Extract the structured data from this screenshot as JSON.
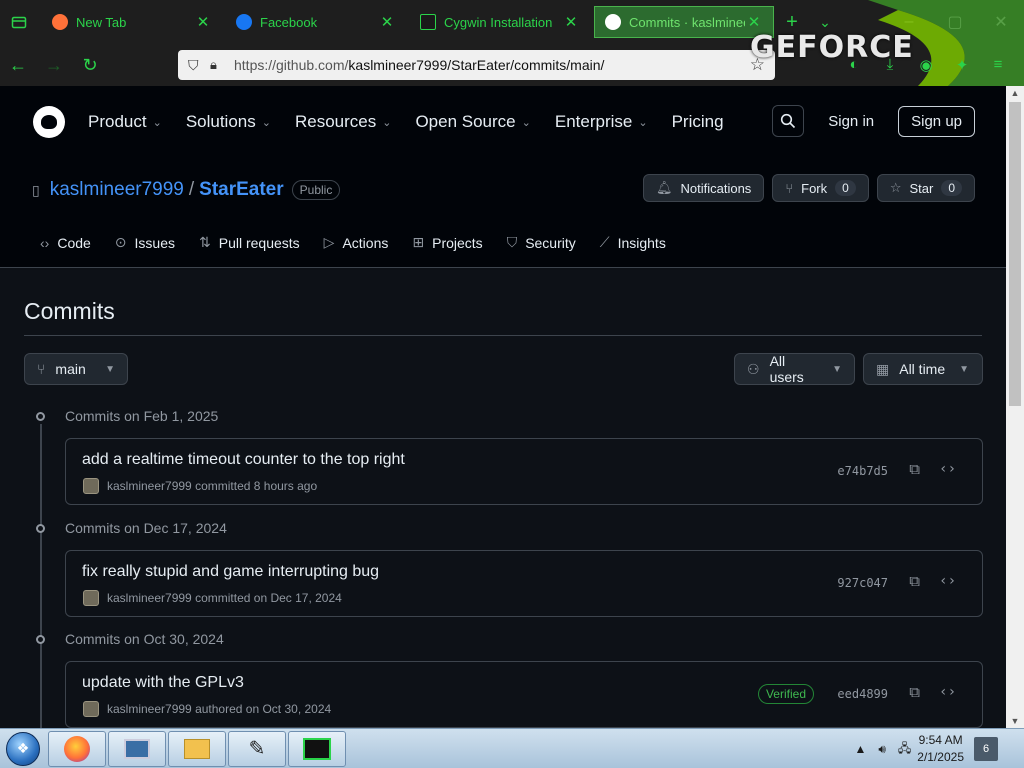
{
  "browser": {
    "tabs": [
      {
        "label": "New Tab",
        "fav_color": "#ff7139"
      },
      {
        "label": "Facebook",
        "fav_color": "#1877f2"
      },
      {
        "label": "Cygwin Installation",
        "fav_color": "#1a1a1a"
      },
      {
        "label": "Commits · kaslmineer",
        "fav_color": "#ffffff"
      }
    ],
    "url_host": "https://github.com/",
    "url_path": "kaslmineer7999/StarEater/commits/main/",
    "overlay_logo": "GEFORCE",
    "accent_color": "#2bd34a"
  },
  "gh_header": {
    "menu": [
      "Product",
      "Solutions",
      "Resources",
      "Open Source",
      "Enterprise",
      "Pricing"
    ],
    "sign_in": "Sign in",
    "sign_up": "Sign up"
  },
  "repo": {
    "owner": "kaslmineer7999",
    "separator": "/",
    "name": "StarEater",
    "visibility": "Public",
    "notifications_label": "Notifications",
    "fork_label": "Fork",
    "fork_count": "0",
    "star_label": "Star",
    "star_count": "0",
    "tabs": [
      "Code",
      "Issues",
      "Pull requests",
      "Actions",
      "Projects",
      "Security",
      "Insights"
    ]
  },
  "commits_page": {
    "title": "Commits",
    "branch": "main",
    "users_filter": "All users",
    "time_filter": "All time",
    "groups": [
      {
        "heading": "Commits on Feb 1, 2025",
        "commits": [
          {
            "message": "add a realtime timeout counter to the top right",
            "author": "kaslmineer7999",
            "action": "committed",
            "when": "8 hours ago",
            "sha": "e74b7d5",
            "verified": ""
          }
        ]
      },
      {
        "heading": "Commits on Dec 17, 2024",
        "commits": [
          {
            "message": "fix really stupid and game interrupting bug",
            "author": "kaslmineer7999",
            "action": "committed",
            "when": "on Dec 17, 2024",
            "sha": "927c047",
            "verified": ""
          }
        ]
      },
      {
        "heading": "Commits on Oct 30, 2024",
        "commits": [
          {
            "message": "update with the GPLv3",
            "author": "kaslmineer7999",
            "action": "authored",
            "when": "on Oct 30, 2024",
            "sha": "eed4899",
            "verified": "Verified"
          }
        ]
      }
    ]
  },
  "taskbar": {
    "time": "9:54 AM",
    "date": "2/1/2025",
    "notification_count": "6"
  }
}
